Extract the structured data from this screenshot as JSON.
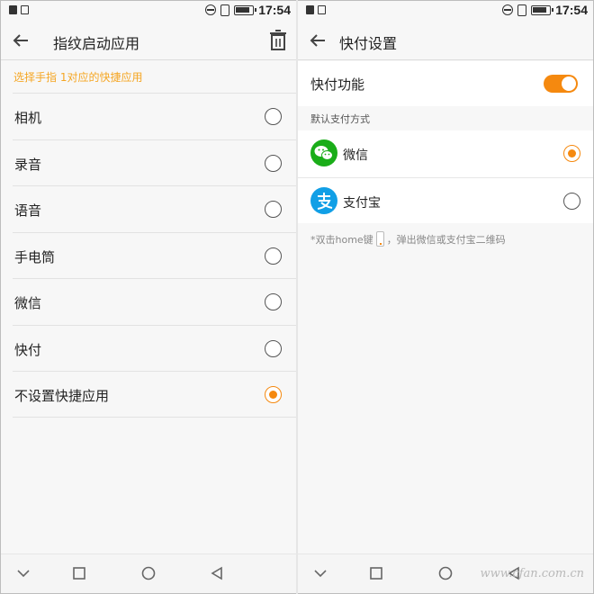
{
  "status_bar": {
    "time": "17:54"
  },
  "left": {
    "title": "指纹启动应用",
    "hint": "选择手指 1对应的快捷应用",
    "options": [
      {
        "label": "相机",
        "selected": false
      },
      {
        "label": "录音",
        "selected": false
      },
      {
        "label": "语音",
        "selected": false
      },
      {
        "label": "手电筒",
        "selected": false
      },
      {
        "label": "微信",
        "selected": false
      },
      {
        "label": "快付",
        "selected": false
      },
      {
        "label": "不设置快捷应用",
        "selected": true
      }
    ]
  },
  "right": {
    "title": "快付设置",
    "quick_pay": {
      "label": "快付功能",
      "enabled": true
    },
    "section_label": "默认支付方式",
    "payments": [
      {
        "label": "微信",
        "icon": "wechat-icon",
        "selected": true
      },
      {
        "label": "支付宝",
        "icon": "alipay-icon",
        "selected": false
      }
    ],
    "footnote_before": "*双击home键",
    "footnote_after": "，弹出微信或支付宝二维码"
  },
  "watermark": "www.cfan.com.cn",
  "colors": {
    "accent": "#f5890f",
    "hint": "#f5a623",
    "wechat": "#1aad19",
    "alipay": "#119fe6"
  }
}
